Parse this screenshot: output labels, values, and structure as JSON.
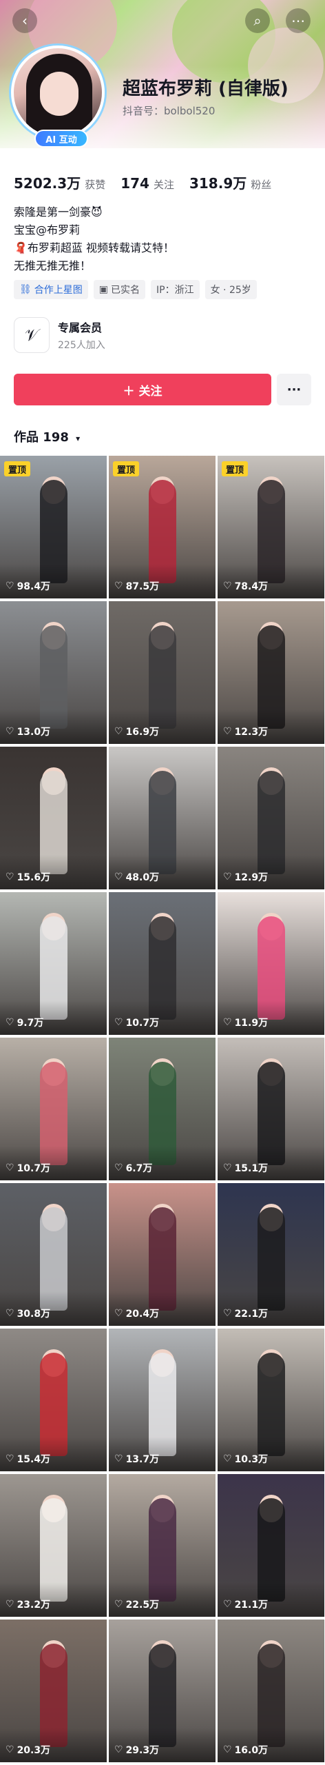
{
  "header": {
    "back_icon": "back-chevron-icon",
    "search_icon": "search-icon",
    "more_icon": "more-icon"
  },
  "profile": {
    "name": "超蓝布罗莉 (自律版)",
    "douyin_id": "抖音号：bolbol520",
    "ai_badge": "AI 互动",
    "stats": [
      {
        "value": "5202.3万",
        "label": "获赞"
      },
      {
        "value": "174",
        "label": "关注"
      },
      {
        "value": "318.9万",
        "label": "粉丝"
      }
    ],
    "bio": [
      "索隆是第一剑豪😈",
      "宝宝@布罗莉",
      "🧣布罗莉超蓝  视频转载请艾特！",
      "无推无推无推！"
    ],
    "tags": [
      {
        "icon": "link-icon",
        "text": "合作上星图",
        "accent": "#2c6cd8"
      },
      {
        "icon": "id-card-icon",
        "text": "已实名"
      },
      {
        "icon": "",
        "text": "IP：浙江"
      },
      {
        "icon": "",
        "text": "女 · 25岁"
      }
    ],
    "membership": {
      "icon": "membership-icon",
      "title": "专属会员",
      "subtitle": "225人加入"
    },
    "follow_label": "＋ 关注",
    "more_label": "···"
  },
  "works": {
    "label": "作品",
    "count": "198",
    "caret": "▾"
  },
  "grid": {
    "pin_label": "置顶",
    "tiles": [
      {
        "likes": "98.4万",
        "pinned": true,
        "bg": "#9aa1a8",
        "fig": "#1f1f22"
      },
      {
        "likes": "87.5万",
        "pinned": true,
        "bg": "#b9a79a",
        "fig": "#b3263a"
      },
      {
        "likes": "78.4万",
        "pinned": true,
        "bg": "#c7c2bd",
        "fig": "#2a2528"
      },
      {
        "likes": "13.0万",
        "pinned": false,
        "bg": "#8c8f93",
        "fig": "#5e5f62"
      },
      {
        "likes": "16.9万",
        "pinned": false,
        "bg": "#6f6a66",
        "fig": "#3b3a3c"
      },
      {
        "likes": "12.3万",
        "pinned": false,
        "bg": "#a79a8f",
        "fig": "#1d1b1c"
      },
      {
        "likes": "15.6万",
        "pinned": false,
        "bg": "#3a3432",
        "fig": "#dcd6d0"
      },
      {
        "likes": "48.0万",
        "pinned": false,
        "bg": "#c9c7c5",
        "fig": "#3d3f44"
      },
      {
        "likes": "12.9万",
        "pinned": false,
        "bg": "#8a8580",
        "fig": "#2b2b2e"
      },
      {
        "likes": "9.7万",
        "pinned": false,
        "bg": "#b4b7b3",
        "fig": "#e6e6e8"
      },
      {
        "likes": "10.7万",
        "pinned": false,
        "bg": "#6b7077",
        "fig": "#2f2e30"
      },
      {
        "likes": "11.9万",
        "pinned": false,
        "bg": "#e8e0dc",
        "fig": "#e94c7e"
      },
      {
        "likes": "10.7万",
        "pinned": false,
        "bg": "#b8b0a7",
        "fig": "#d4606e"
      },
      {
        "likes": "6.7万",
        "pinned": false,
        "bg": "#7e8478",
        "fig": "#2f5a3a"
      },
      {
        "likes": "15.1万",
        "pinned": false,
        "bg": "#c4beb9",
        "fig": "#1a1a1c"
      },
      {
        "likes": "30.8万",
        "pinned": false,
        "bg": "#5d6066",
        "fig": "#c8c9cc"
      },
      {
        "likes": "20.4万",
        "pinned": false,
        "bg": "#c9928a",
        "fig": "#5a2436"
      },
      {
        "likes": "22.1万",
        "pinned": false,
        "bg": "#2e3550",
        "fig": "#1c1c1e"
      },
      {
        "likes": "15.4万",
        "pinned": false,
        "bg": "#8f8a86",
        "fig": "#c82c32"
      },
      {
        "likes": "13.7万",
        "pinned": false,
        "bg": "#b2b5b8",
        "fig": "#eaeaec"
      },
      {
        "likes": "10.3万",
        "pinned": false,
        "bg": "#c3bdb6",
        "fig": "#1e1e20"
      },
      {
        "likes": "23.2万",
        "pinned": false,
        "bg": "#9d9791",
        "fig": "#f1efeb"
      },
      {
        "likes": "22.5万",
        "pinned": false,
        "bg": "#b4aaa1",
        "fig": "#4a2a44"
      },
      {
        "likes": "21.1万",
        "pinned": false,
        "bg": "#3c344a",
        "fig": "#18171a"
      },
      {
        "likes": "20.3万",
        "pinned": false,
        "bg": "#7c6f66",
        "fig": "#8b2530"
      },
      {
        "likes": "29.3万",
        "pinned": false,
        "bg": "#a7a19c",
        "fig": "#222124"
      },
      {
        "likes": "16.0万",
        "pinned": false,
        "bg": "#8e8882",
        "fig": "#2a2426"
      }
    ]
  }
}
